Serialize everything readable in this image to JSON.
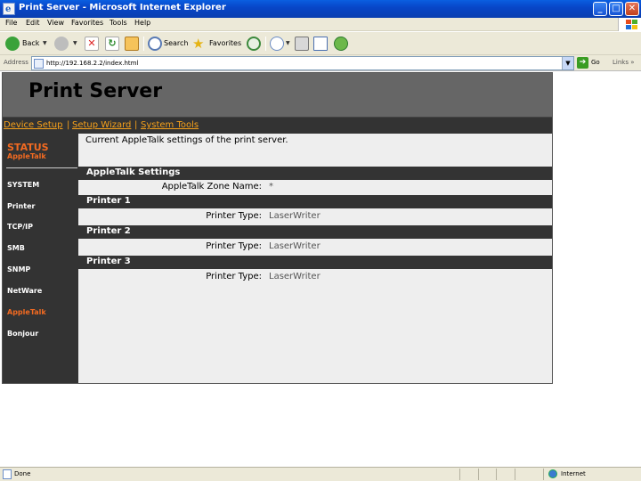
{
  "window": {
    "title": "Print Server - Microsoft Internet Explorer",
    "icon": "ie-page-icon"
  },
  "menu": [
    "File",
    "Edit",
    "View",
    "Favorites",
    "Tools",
    "Help"
  ],
  "toolbar": {
    "back": "Back",
    "search": "Search",
    "favorites": "Favorites"
  },
  "address": {
    "label": "Address",
    "url": "http://192.168.2.2/index.html",
    "go": "Go",
    "links": "Links"
  },
  "page": {
    "title": "Print Server",
    "nav": [
      "Device Setup",
      "Setup Wizard",
      "System Tools"
    ],
    "sidebar": {
      "heading": "STATUS",
      "subheading": "AppleTalk",
      "items": [
        "SYSTEM",
        "Printer",
        "TCP/IP",
        "SMB",
        "SNMP",
        "NetWare",
        "AppleTalk",
        "Bonjour"
      ],
      "active": "AppleTalk"
    },
    "intro": "Current AppleTalk settings of the print server.",
    "settings": {
      "header": "AppleTalk Settings",
      "zone_label": "AppleTalk Zone Name:",
      "zone_value": "*"
    },
    "printers": [
      {
        "header": "Printer 1",
        "label": "Printer Type:",
        "value": "LaserWriter"
      },
      {
        "header": "Printer 2",
        "label": "Printer Type:",
        "value": "LaserWriter"
      },
      {
        "header": "Printer 3",
        "label": "Printer Type:",
        "value": "LaserWriter"
      }
    ]
  },
  "status": {
    "text": "Done",
    "zone": "Internet"
  },
  "colors": {
    "accent": "#f26a21",
    "nav_link": "#f7a11a",
    "dark": "#333333",
    "header_bg": "#666666",
    "content_bg": "#eeeeee"
  }
}
